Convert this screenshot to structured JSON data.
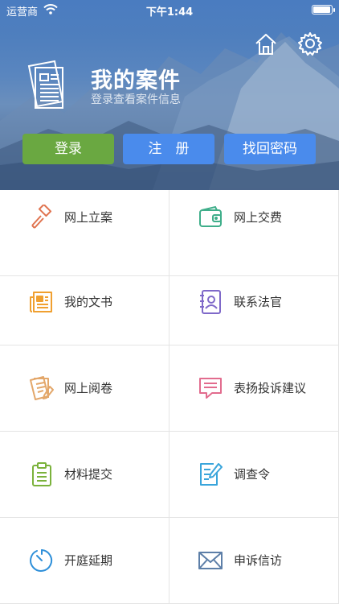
{
  "status_bar": {
    "carrier": "运营商",
    "time": "下午1:44"
  },
  "header": {
    "title": "我的案件",
    "subtitle": "登录查看案件信息"
  },
  "auth_buttons": {
    "login": "登录",
    "register": "注　册",
    "recover": "找回密码"
  },
  "menu": [
    {
      "label": "网上立案",
      "icon": "gavel-icon"
    },
    {
      "label": "网上交费",
      "icon": "wallet-icon"
    },
    {
      "label": "我的文书",
      "icon": "newspaper-icon"
    },
    {
      "label": "联系法官",
      "icon": "contact-book-icon"
    },
    {
      "label": "网上阅卷",
      "icon": "document-edit-icon"
    },
    {
      "label": "表扬投诉建议",
      "icon": "message-icon"
    },
    {
      "label": "材料提交",
      "icon": "clipboard-icon"
    },
    {
      "label": "调查令",
      "icon": "form-edit-icon"
    },
    {
      "label": "开庭延期",
      "icon": "timer-icon"
    },
    {
      "label": "申诉信访",
      "icon": "envelope-icon"
    }
  ],
  "colors": {
    "login": "#6aa841",
    "primary": "#4a8bec",
    "gavel": "#e0734f",
    "wallet": "#3fae8a",
    "newspaper": "#f0a030",
    "contact": "#7f69c9",
    "document": "#e3a76a",
    "message": "#e26c8e",
    "clipboard": "#7bb23c",
    "form": "#3aa5db",
    "timer": "#2e8fd9",
    "envelope": "#5d7fa8"
  }
}
